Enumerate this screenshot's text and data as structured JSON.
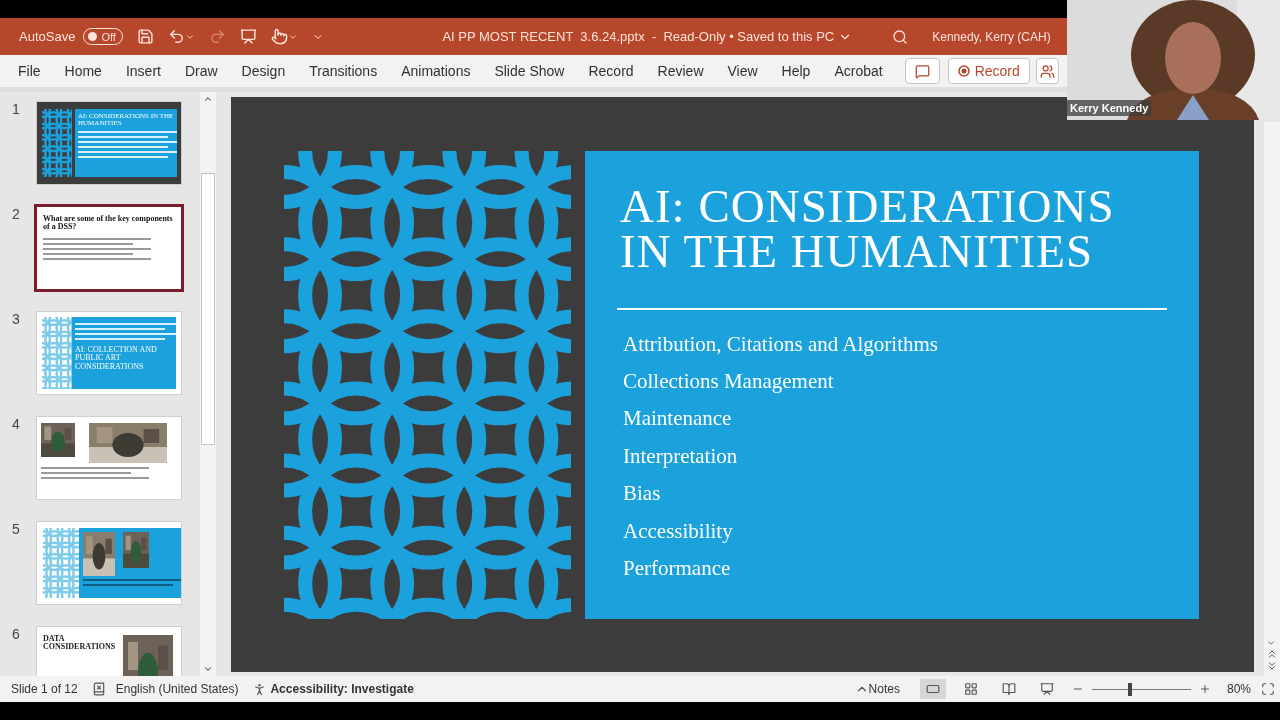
{
  "title_bar": {
    "autosave_label": "AutoSave",
    "autosave": {
      "on": false,
      "label": "Off"
    },
    "file_title": "AI PP MOST RECENT  3.6.24.pptx  -  Read-Only • Saved to this PC",
    "user": "Kennedy, Kerry (CAH)"
  },
  "ribbon_tabs": [
    "File",
    "Home",
    "Insert",
    "Draw",
    "Design",
    "Transitions",
    "Animations",
    "Slide Show",
    "Record",
    "Review",
    "View",
    "Help",
    "Acrobat"
  ],
  "ribbon_record": "Record",
  "thumbnails": [
    {
      "number": "1",
      "kind": "title",
      "selected": false,
      "title": "AI: CONSIDERATIONS IN THE HUMANITIES"
    },
    {
      "number": "2",
      "kind": "text",
      "selected": true,
      "title": "What are some of the key components of a DSS?"
    },
    {
      "number": "3",
      "kind": "collection",
      "selected": false,
      "title": "AI: COLLECTION AND PUBLIC ART CONSIDERATIONS"
    },
    {
      "number": "4",
      "kind": "photos",
      "selected": false
    },
    {
      "number": "5",
      "kind": "monuments",
      "selected": false
    },
    {
      "number": "6",
      "kind": "data",
      "selected": false,
      "title": "DATA CONSIDERATIONS"
    }
  ],
  "slide": {
    "title": "AI: CONSIDERATIONS IN THE HUMANITIES",
    "items": [
      "Attribution, Citations and Algorithms",
      "Collections Management",
      "Maintenance",
      "Interpretation",
      "Bias",
      "Accessibility",
      "Performance"
    ]
  },
  "status_bar": {
    "slide": "Slide 1 of 12",
    "language": "English (United States)",
    "accessibility": "Accessibility: Investigate",
    "notes": "Notes",
    "zoom": "80%",
    "zoom_slider": {
      "level": 0.38
    }
  },
  "video": {
    "name": "Kerry Kennedy"
  }
}
